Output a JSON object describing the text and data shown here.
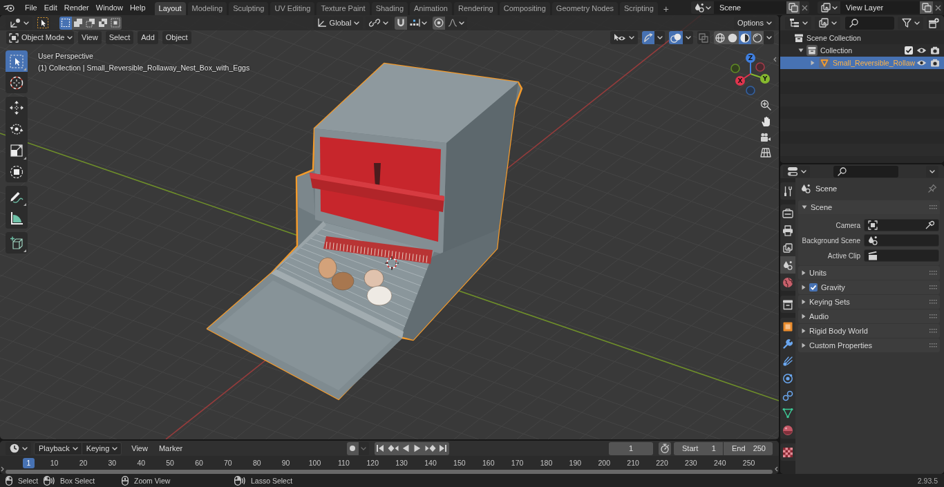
{
  "top_bar": {
    "menus": [
      "File",
      "Edit",
      "Render",
      "Window",
      "Help"
    ],
    "workspaces": [
      {
        "label": "Layout",
        "selected": true
      },
      {
        "label": "Modeling",
        "selected": false
      },
      {
        "label": "Sculpting",
        "selected": false
      },
      {
        "label": "UV Editing",
        "selected": false
      },
      {
        "label": "Texture Paint",
        "selected": false
      },
      {
        "label": "Shading",
        "selected": false
      },
      {
        "label": "Animation",
        "selected": false
      },
      {
        "label": "Rendering",
        "selected": false
      },
      {
        "label": "Compositing",
        "selected": false
      },
      {
        "label": "Geometry Nodes",
        "selected": false
      },
      {
        "label": "Scripting",
        "selected": false
      }
    ],
    "add_workspace": "+",
    "scene": "Scene",
    "view_layer": "View Layer"
  },
  "viewport": {
    "tool_header": {
      "select_modes": [
        {
          "kind": "set",
          "selected": true
        },
        {
          "kind": "extend",
          "selected": false
        },
        {
          "kind": "subtract",
          "selected": false
        },
        {
          "kind": "invert",
          "selected": false
        },
        {
          "kind": "intersect",
          "selected": false
        }
      ],
      "orientation": "Global",
      "snap": {
        "on": false
      },
      "proportional": {
        "on": false
      },
      "options": "Options"
    },
    "header": {
      "mode": "Object Mode",
      "menus": [
        "View",
        "Select",
        "Add",
        "Object"
      ],
      "gizmos": {
        "on": true
      },
      "overlays": {
        "on": true
      },
      "xray": {
        "on": false
      },
      "shading": [
        {
          "kind": "wireframe",
          "selected": false
        },
        {
          "kind": "solid",
          "selected": false
        },
        {
          "kind": "material",
          "selected": true
        },
        {
          "kind": "rendered",
          "selected": false
        }
      ]
    },
    "tool_groups": [
      [
        {
          "kind": "select_box",
          "selected": true,
          "flyout": true
        },
        {
          "kind": "cursor",
          "selected": false,
          "flyout": false
        }
      ],
      [
        {
          "kind": "move",
          "selected": false,
          "flyout": false
        },
        {
          "kind": "rotate",
          "selected": false,
          "flyout": false
        },
        {
          "kind": "scale",
          "selected": false,
          "flyout": true
        },
        {
          "kind": "transform",
          "selected": false,
          "flyout": false
        }
      ],
      [
        {
          "kind": "annotate",
          "selected": false,
          "flyout": true
        },
        {
          "kind": "measure",
          "selected": false,
          "flyout": false
        }
      ],
      [
        {
          "kind": "add_cube",
          "selected": false,
          "flyout": true
        }
      ]
    ],
    "overlay": {
      "view_name": "User Perspective",
      "object_info": "(1) Collection | Small_Reversible_Rollaway_Nest_Box_with_Eggs"
    },
    "gizmo_axes": [
      {
        "kind": "z",
        "label": "Z"
      },
      {
        "kind": "y",
        "label": "Y"
      },
      {
        "kind": "x",
        "label": "X"
      }
    ],
    "nav_buttons": [
      {
        "kind": "zoom"
      },
      {
        "kind": "pan"
      },
      {
        "kind": "camera"
      },
      {
        "kind": "ortho"
      }
    ]
  },
  "timeline": {
    "menus": [
      {
        "label": "Playback",
        "kind": "dropdown"
      },
      {
        "label": "Keying",
        "kind": "dropdown"
      },
      {
        "label": "View",
        "kind": "menu"
      },
      {
        "label": "Marker",
        "kind": "menu"
      }
    ],
    "auto_key": {
      "on": false
    },
    "keying_options": {
      "disabled": true
    },
    "transport": [
      {
        "kind": "jump_start"
      },
      {
        "kind": "key_back"
      },
      {
        "kind": "play_reverse"
      },
      {
        "kind": "play"
      },
      {
        "kind": "key_forward"
      },
      {
        "kind": "jump_end"
      }
    ],
    "current_frame": "1",
    "preview_range": {
      "on": false
    },
    "start": {
      "label": "Start",
      "value": "1"
    },
    "end": {
      "label": "End",
      "value": "250"
    },
    "playhead": "1",
    "ticks": [
      "10",
      "20",
      "30",
      "40",
      "50",
      "60",
      "70",
      "80",
      "90",
      "100",
      "110",
      "120",
      "130",
      "140",
      "150",
      "160",
      "170",
      "180",
      "190",
      "200",
      "210",
      "220",
      "230",
      "240",
      "250"
    ]
  },
  "status_bar": {
    "hints": [
      {
        "kind": "left_click",
        "label": "Select"
      },
      {
        "kind": "left_drag",
        "label": "Box Select"
      },
      {
        "kind": "middle_drag",
        "label": "Zoom View"
      },
      {
        "kind": "right_drag",
        "label": "Lasso Select"
      }
    ],
    "version": "2.93.5"
  },
  "outliner": {
    "tree": [
      {
        "label": "Scene Collection",
        "kind": "scene_collection",
        "selected": false,
        "children": [
          {
            "label": "Collection",
            "kind": "collection",
            "selected": false,
            "expanded": true,
            "checked": true,
            "children": [
              {
                "label": "Small_Reversible_Rollaw",
                "kind": "mesh_object",
                "selected": true,
                "expanded": false
              }
            ]
          }
        ]
      }
    ]
  },
  "properties": {
    "tab_groups": [
      [
        {
          "kind": "tool",
          "selected": false
        }
      ],
      [
        {
          "kind": "render",
          "selected": false
        },
        {
          "kind": "output",
          "selected": false
        },
        {
          "kind": "view_layer",
          "selected": false
        },
        {
          "kind": "scene",
          "selected": true
        },
        {
          "kind": "world",
          "selected": false
        }
      ],
      [
        {
          "kind": "collection",
          "selected": false
        }
      ],
      [
        {
          "kind": "object",
          "selected": false
        },
        {
          "kind": "modifiers",
          "selected": false
        },
        {
          "kind": "particles",
          "selected": false
        },
        {
          "kind": "physics",
          "selected": false
        },
        {
          "kind": "constraints",
          "selected": false
        },
        {
          "kind": "data",
          "selected": false
        },
        {
          "kind": "material",
          "selected": false
        }
      ],
      [
        {
          "kind": "texture",
          "selected": false
        }
      ]
    ],
    "context": "Scene",
    "panels": [
      {
        "label": "Scene",
        "expanded": true,
        "fields": [
          {
            "label": "Camera",
            "kind": "camera"
          },
          {
            "label": "Background Scene",
            "kind": "scene"
          },
          {
            "label": "Active Clip",
            "kind": "clip"
          }
        ]
      },
      {
        "label": "Units",
        "expanded": false
      },
      {
        "label": "Gravity",
        "expanded": false,
        "checked": true
      },
      {
        "label": "Keying Sets",
        "expanded": false
      },
      {
        "label": "Audio",
        "expanded": false
      },
      {
        "label": "Rigid Body World",
        "expanded": false
      },
      {
        "label": "Custom Properties",
        "expanded": false
      }
    ]
  }
}
